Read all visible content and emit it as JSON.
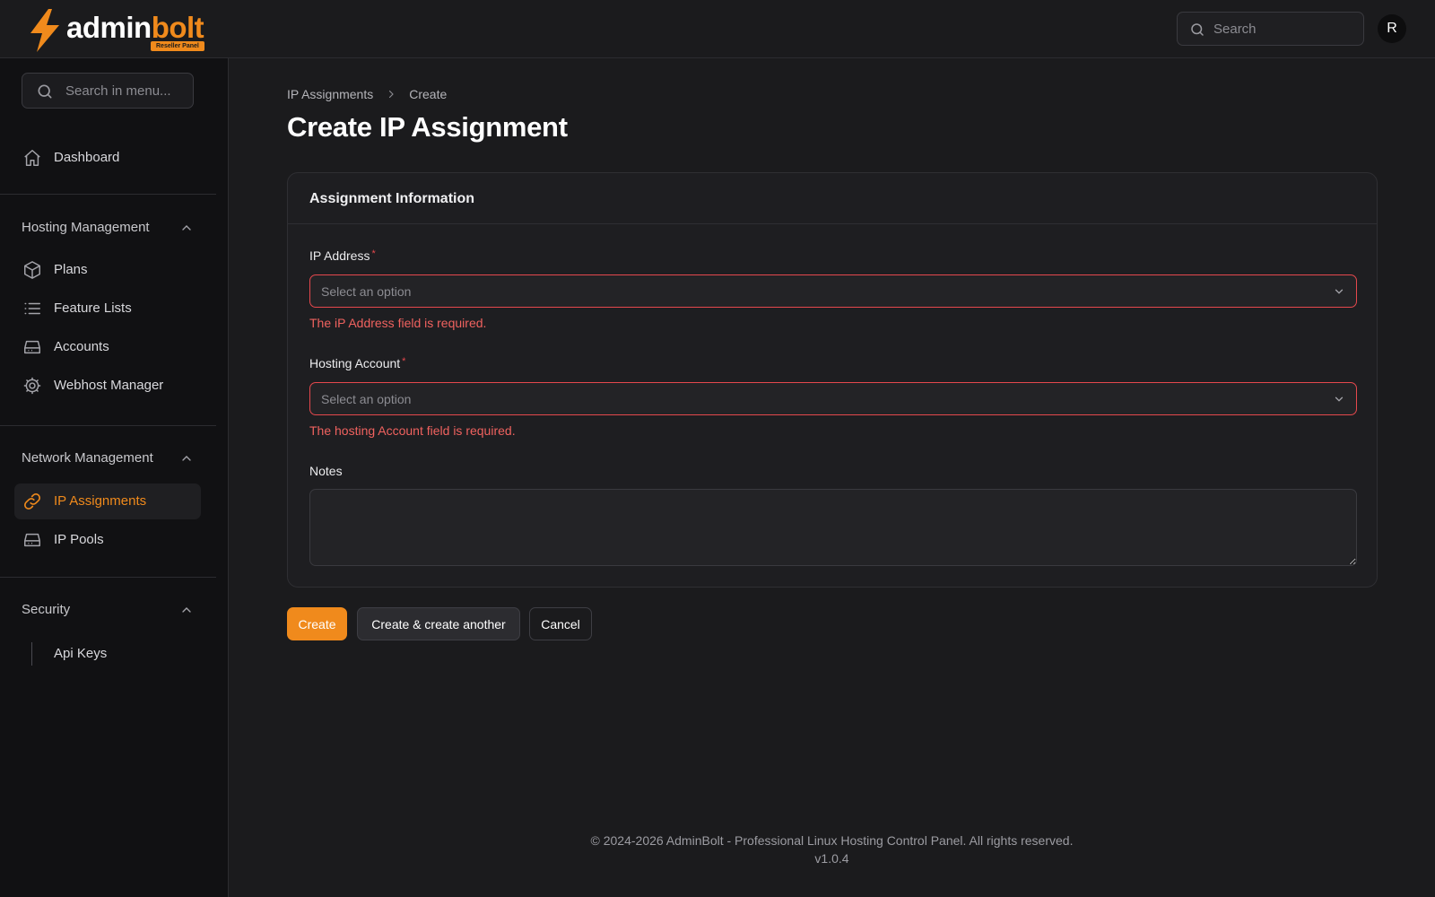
{
  "app": {
    "logo_word_1": "admin",
    "logo_word_2": "bolt",
    "logo_badge": "Reseller Panel",
    "accent_color": "#f08a1c",
    "error_color": "#f0625f"
  },
  "topbar": {
    "search_placeholder": "Search",
    "avatar_initial": "R"
  },
  "sidebar": {
    "search_placeholder": "Search in menu...",
    "dashboard": {
      "label": "Dashboard",
      "icon": "home-icon"
    },
    "groups": [
      {
        "label": "Hosting Management",
        "items": [
          {
            "label": "Plans",
            "icon": "cube-icon"
          },
          {
            "label": "Feature Lists",
            "icon": "list-icon"
          },
          {
            "label": "Accounts",
            "icon": "server-icon"
          },
          {
            "label": "Webhost Manager",
            "icon": "gear-icon"
          }
        ]
      },
      {
        "label": "Network Management",
        "items": [
          {
            "label": "IP Assignments",
            "icon": "link-icon",
            "active": true
          },
          {
            "label": "IP Pools",
            "icon": "server-icon"
          }
        ]
      },
      {
        "label": "Security",
        "items": [
          {
            "label": "Api Keys"
          }
        ]
      }
    ]
  },
  "main": {
    "breadcrumb": [
      "IP Assignments",
      "Create"
    ],
    "title": "Create IP Assignment",
    "card_title": "Assignment Information",
    "fields": {
      "ip_address": {
        "label": "IP Address",
        "required_mark": "*",
        "placeholder": "Select an option",
        "error": "The iP Address field is required."
      },
      "hosting_account": {
        "label": "Hosting Account",
        "required_mark": "*",
        "placeholder": "Select an option",
        "error": "The hosting Account field is required."
      },
      "notes": {
        "label": "Notes",
        "value": ""
      }
    },
    "buttons": {
      "create": "Create",
      "create_another": "Create & create another",
      "cancel": "Cancel"
    }
  },
  "footer": {
    "copyright": "© 2024-2026 AdminBolt - Professional Linux Hosting Control Panel. All rights reserved.",
    "version": "v1.0.4"
  }
}
